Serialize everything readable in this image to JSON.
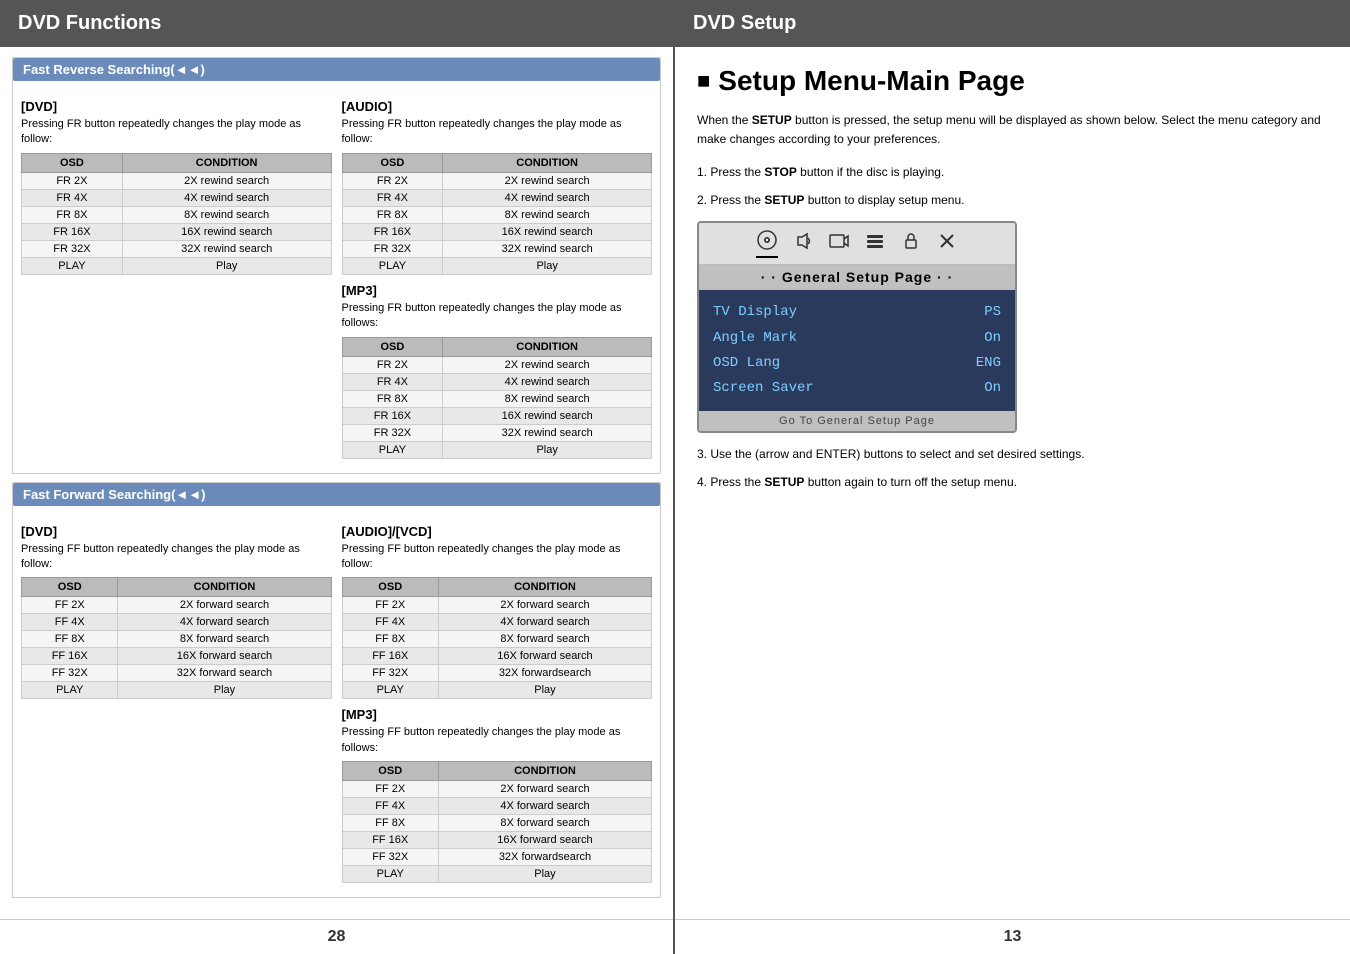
{
  "left": {
    "header": "DVD Functions",
    "page_number": "28",
    "fast_reverse": {
      "section_title": "Fast Reverse Searching(◄◄)",
      "dvd": {
        "label": "[DVD]",
        "desc": "Pressing FR button repeatedly changes the play mode as follow:",
        "table": {
          "headers": [
            "OSD",
            "CONDITION"
          ],
          "rows": [
            [
              "FR 2X",
              "2X rewind search"
            ],
            [
              "FR 4X",
              "4X rewind search"
            ],
            [
              "FR 8X",
              "8X rewind search"
            ],
            [
              "FR 16X",
              "16X rewind search"
            ],
            [
              "FR 32X",
              "32X rewind search"
            ],
            [
              "PLAY",
              "Play"
            ]
          ]
        }
      },
      "audio": {
        "label": "[AUDIO]",
        "desc": "Pressing FR button repeatedly changes the play mode as follow:",
        "table": {
          "headers": [
            "OSD",
            "CONDITION"
          ],
          "rows": [
            [
              "FR 2X",
              "2X rewind search"
            ],
            [
              "FR 4X",
              "4X rewind search"
            ],
            [
              "FR 8X",
              "8X rewind search"
            ],
            [
              "FR 16X",
              "16X rewind search"
            ],
            [
              "FR 32X",
              "32X rewind search"
            ],
            [
              "PLAY",
              "Play"
            ]
          ]
        }
      },
      "mp3": {
        "label": "[MP3]",
        "desc": "Pressing FR button repeatedly changes the play mode as follows:",
        "table": {
          "headers": [
            "OSD",
            "CONDITION"
          ],
          "rows": [
            [
              "FR 2X",
              "2X rewind search"
            ],
            [
              "FR 4X",
              "4X rewind search"
            ],
            [
              "FR 8X",
              "8X rewind search"
            ],
            [
              "FR 16X",
              "16X rewind search"
            ],
            [
              "FR 32X",
              "32X rewind search"
            ],
            [
              "PLAY",
              "Play"
            ]
          ]
        }
      }
    },
    "fast_forward": {
      "section_title": "Fast Forward Searching(◄◄)",
      "dvd": {
        "label": "[DVD]",
        "desc": "Pressing FF button repeatedly changes the play mode as follow:",
        "table": {
          "headers": [
            "OSD",
            "CONDITION"
          ],
          "rows": [
            [
              "FF 2X",
              "2X forward search"
            ],
            [
              "FF 4X",
              "4X forward search"
            ],
            [
              "FF 8X",
              "8X forward search"
            ],
            [
              "FF 16X",
              "16X forward search"
            ],
            [
              "FF 32X",
              "32X forward search"
            ],
            [
              "PLAY",
              "Play"
            ]
          ]
        }
      },
      "audio_vcd": {
        "label": "[AUDIO]/[VCD]",
        "desc": "Pressing FF button repeatedly changes the play mode as follow:",
        "table": {
          "headers": [
            "OSD",
            "CONDITION"
          ],
          "rows": [
            [
              "FF 2X",
              "2X forward search"
            ],
            [
              "FF 4X",
              "4X forward search"
            ],
            [
              "FF 8X",
              "8X forward search"
            ],
            [
              "FF 16X",
              "16X forward search"
            ],
            [
              "FF 32X",
              "32X forwardsearch"
            ],
            [
              "PLAY",
              "Play"
            ]
          ]
        }
      },
      "mp3": {
        "label": "[MP3]",
        "desc": "Pressing FF button repeatedly changes the play mode as follows:",
        "table": {
          "headers": [
            "OSD",
            "CONDITION"
          ],
          "rows": [
            [
              "FF 2X",
              "2X forward search"
            ],
            [
              "FF 4X",
              "4X forward search"
            ],
            [
              "FF 8X",
              "8X forward search"
            ],
            [
              "FF 16X",
              "16X forward search"
            ],
            [
              "FF 32X",
              "32X forwardsearch"
            ],
            [
              "PLAY",
              "Play"
            ]
          ]
        }
      }
    }
  },
  "right": {
    "header": "DVD Setup",
    "page_number": "13",
    "setup_title": "Setup Menu-Main Page",
    "desc": "When the SETUP button is pressed, the setup menu will be displayed as shown below. Select the menu category and make changes according to your preferences.",
    "steps": [
      {
        "num": "1.",
        "text": "Press the ",
        "bold": "STOP",
        "after": " button if the disc is playing."
      },
      {
        "num": "2.",
        "text": "Press the ",
        "bold": "SETUP",
        "after": " button to display setup menu."
      },
      {
        "num": "3.",
        "text": "Use the (arrow and ENTER) buttons to select and set desired settings."
      },
      {
        "num": "4.",
        "text": "Press the ",
        "bold": "SETUP",
        "after": " button again to turn off the setup menu."
      }
    ],
    "menu": {
      "icons": [
        "📀",
        "🔊",
        "📺",
        "🔧",
        "🔒",
        "✕"
      ],
      "title": "· · General Setup Page · ·",
      "rows": [
        {
          "label": "TV Display",
          "value": "PS"
        },
        {
          "label": "Angle Mark",
          "value": "On"
        },
        {
          "label": "OSD Lang",
          "value": "ENG"
        },
        {
          "label": "Screen Saver",
          "value": "On"
        }
      ],
      "footer": "Go To General Setup Page"
    }
  }
}
